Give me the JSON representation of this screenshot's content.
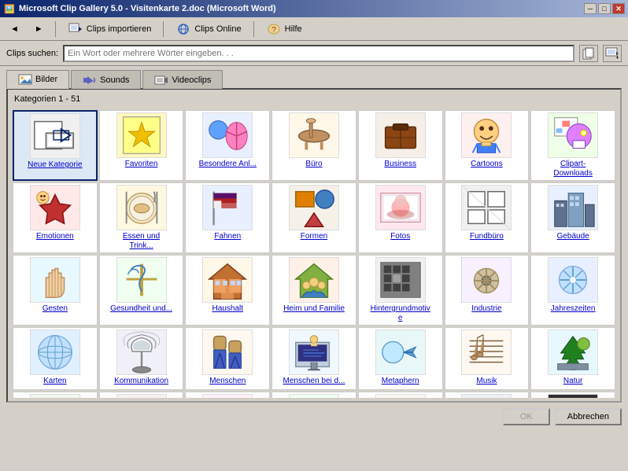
{
  "window": {
    "title": "Microsoft Clip Gallery 5.0 - Visitenkarte 2.doc (Microsoft Word)",
    "icon": "🖼️"
  },
  "titlebar": {
    "minimize_label": "─",
    "maximize_label": "□",
    "close_label": "✕"
  },
  "menu": {
    "back_label": "←",
    "forward_label": "→",
    "clips_import_label": "Clips importieren",
    "clips_online_label": "Clips Online",
    "help_label": "Hilfe"
  },
  "search": {
    "label": "Clips suchen:",
    "placeholder": "Ein Wort oder mehrere Wörter eingeben. . .",
    "btn1_label": "📋",
    "btn2_label": "🔍"
  },
  "tabs": [
    {
      "id": "bilder",
      "label": "Bilder",
      "active": true
    },
    {
      "id": "sounds",
      "label": "Sounds",
      "active": false
    },
    {
      "id": "videoclips",
      "label": "Videoclips",
      "active": false
    }
  ],
  "category_label": "Kategorien 1 - 51",
  "grid_items": [
    {
      "id": "neue-kategorie",
      "label": "Neue Kategorie",
      "emoji": "↗",
      "color": "#f0f0f0",
      "selected": true
    },
    {
      "id": "favoriten",
      "label": "Favoriten",
      "emoji": "⭐",
      "color": "#fff8c0"
    },
    {
      "id": "besondere-anl",
      "label": "Besondere Anl...",
      "emoji": "🎈",
      "color": "#e8f0ff"
    },
    {
      "id": "buero",
      "label": "Büro",
      "emoji": "📎",
      "color": "#fff8e8"
    },
    {
      "id": "business",
      "label": "Business",
      "emoji": "💼",
      "color": "#f5efe8"
    },
    {
      "id": "cartoons",
      "label": "Cartoons",
      "emoji": "🧑",
      "color": "#fff0f0"
    },
    {
      "id": "clipart-downloads",
      "label": "Clipart-Downloads",
      "emoji": "🌸",
      "color": "#f0ffe8"
    },
    {
      "id": "emotionen",
      "label": "Emotionen",
      "emoji": "❤️",
      "color": "#ffe8e8"
    },
    {
      "id": "essen-und-trink",
      "label": "Essen und Trink...",
      "emoji": "🍽️",
      "color": "#fff8e0"
    },
    {
      "id": "fahnen",
      "label": "Fahnen",
      "emoji": "🏳️",
      "color": "#e8f0ff"
    },
    {
      "id": "formen",
      "label": "Formen",
      "emoji": "🔷",
      "color": "#f5f0e8"
    },
    {
      "id": "fotos",
      "label": "Fotos",
      "emoji": "🌷",
      "color": "#ffe8f0"
    },
    {
      "id": "fundbuero",
      "label": "Fundbüro",
      "emoji": "⊞",
      "color": "#f0f0f0"
    },
    {
      "id": "gebaeude",
      "label": "Gebäude",
      "emoji": "🏙️",
      "color": "#e8f0ff"
    },
    {
      "id": "gesten",
      "label": "Gesten",
      "emoji": "✋",
      "color": "#e8f8ff"
    },
    {
      "id": "gesundheit-und",
      "label": "Gesundheit und...",
      "emoji": "⚕️",
      "color": "#f0fff0"
    },
    {
      "id": "haushalt",
      "label": "Haushalt",
      "emoji": "🏠",
      "color": "#fff8e8"
    },
    {
      "id": "heim-und-familie",
      "label": "Heim und Familie",
      "emoji": "👨‍👩‍👧",
      "color": "#fff0e8"
    },
    {
      "id": "hintergrundmotive",
      "label": "Hintergrundmotive",
      "emoji": "⬛",
      "color": "#f0f0f0"
    },
    {
      "id": "industrie",
      "label": "Industrie",
      "emoji": "⚙️",
      "color": "#f8f0ff"
    },
    {
      "id": "jahreszeiten",
      "label": "Jahreszeiten",
      "emoji": "❄️",
      "color": "#e8f0ff"
    },
    {
      "id": "karten",
      "label": "Karten",
      "emoji": "🌐",
      "color": "#e0f0ff"
    },
    {
      "id": "kommunikation",
      "label": "Kommunikation",
      "emoji": "📡",
      "color": "#f0f0f8"
    },
    {
      "id": "menschen",
      "label": "Menschen",
      "emoji": "🧩",
      "color": "#fff8f0"
    },
    {
      "id": "menschen-bei-d",
      "label": "Menschen bei d...",
      "emoji": "💻",
      "color": "#f0f8ff"
    },
    {
      "id": "metaphern",
      "label": "Metaphern",
      "emoji": "➡️",
      "color": "#e8f8f8"
    },
    {
      "id": "musik",
      "label": "Musik",
      "emoji": "🎵",
      "color": "#fff8f0"
    },
    {
      "id": "natur",
      "label": "Natur",
      "emoji": "🌲",
      "color": "#e8f8ff"
    },
    {
      "id": "partial1",
      "label": "",
      "emoji": "🌿",
      "color": "#f0f8f0"
    },
    {
      "id": "partial2",
      "label": "",
      "emoji": "🧯",
      "color": "#f8f0f0"
    },
    {
      "id": "partial3",
      "label": "",
      "emoji": "🌸",
      "color": "#fff0f8"
    },
    {
      "id": "partial4",
      "label": "",
      "emoji": "🍀",
      "color": "#f0fff0"
    },
    {
      "id": "partial5",
      "label": "",
      "emoji": "🪞",
      "color": "#f8f8f0"
    },
    {
      "id": "partial6",
      "label": "",
      "emoji": "⬡",
      "color": "#f0f0f8"
    },
    {
      "id": "partial7",
      "label": "",
      "emoji": "◼",
      "color": "#303030"
    }
  ],
  "bottom": {
    "ok_label": "OK",
    "cancel_label": "Abbrechen"
  }
}
